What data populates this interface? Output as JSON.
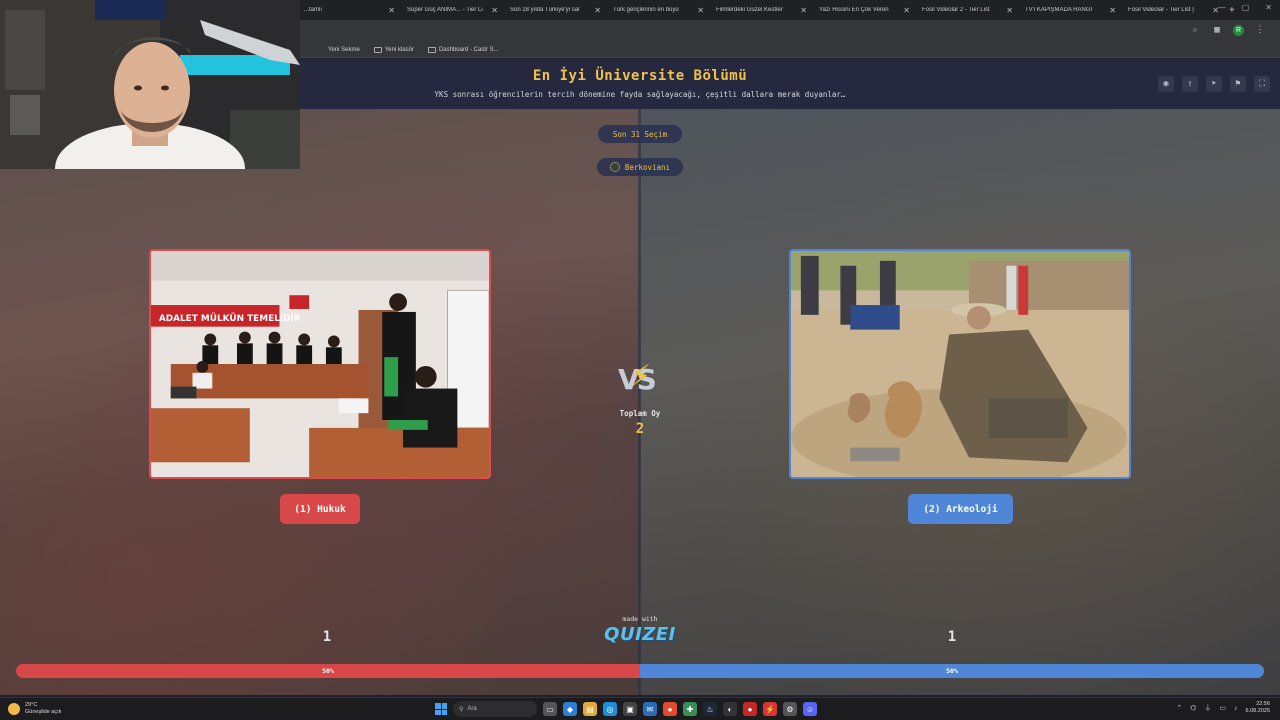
{
  "browser": {
    "tabs": [
      {
        "label": "...tamlı"
      },
      {
        "label": "Süper Güç ANIMA... - Tier Li"
      },
      {
        "label": "Son 28 yılda Türkiye'yi sal"
      },
      {
        "label": "Türk gençlerinin en büyü"
      },
      {
        "label": "Filmlerdeki Güzel Kestler"
      },
      {
        "label": "Yazı Hissini En Çok Veren"
      },
      {
        "label": "Fosil Videolar 2 - Tier List"
      },
      {
        "label": "TV'i KAPIŞMADA HANGI"
      },
      {
        "label": "Fosil Videolar - Tier List | "
      }
    ],
    "new_tab": "+",
    "avatar_letter": "R",
    "bookmarks": [
      {
        "label": "Yeni Sekme"
      },
      {
        "label": "Yeni klasör"
      },
      {
        "label": "Dashboard - Castr S..."
      }
    ]
  },
  "quiz": {
    "title": "En İyi Üniversite Bölümü",
    "subtitle": "YKS sonrası öğrencilerin tercih dönemine fayda sağlayacağı, çeşitli dallara merak duyanlar…",
    "last_pick_label": "Son 31 Seçim",
    "user_name": "Berkovianı",
    "vs_text": "VS",
    "total_label": "Toplam Oy",
    "total_value": "2",
    "left_option": {
      "label": "(1) Hukuk",
      "count": "1",
      "percent_label": "50%",
      "percent": 50
    },
    "right_option": {
      "label": "(2) Arkeoloji",
      "count": "1",
      "percent_label": "50%",
      "percent": 50
    },
    "made_with": "made with",
    "brand": "QUIZEI",
    "left_banner_text": "ADALET MÜLKÜN TEMELİDİR"
  },
  "colors": {
    "left": "#d84848",
    "right": "#4f86d8",
    "accent": "#f0c24b"
  },
  "taskbar": {
    "weather_temp": "29°C",
    "weather_desc": "Güneşlide açık",
    "search_placeholder": "Ara",
    "time": "22:56",
    "date": "6.08.2025"
  }
}
